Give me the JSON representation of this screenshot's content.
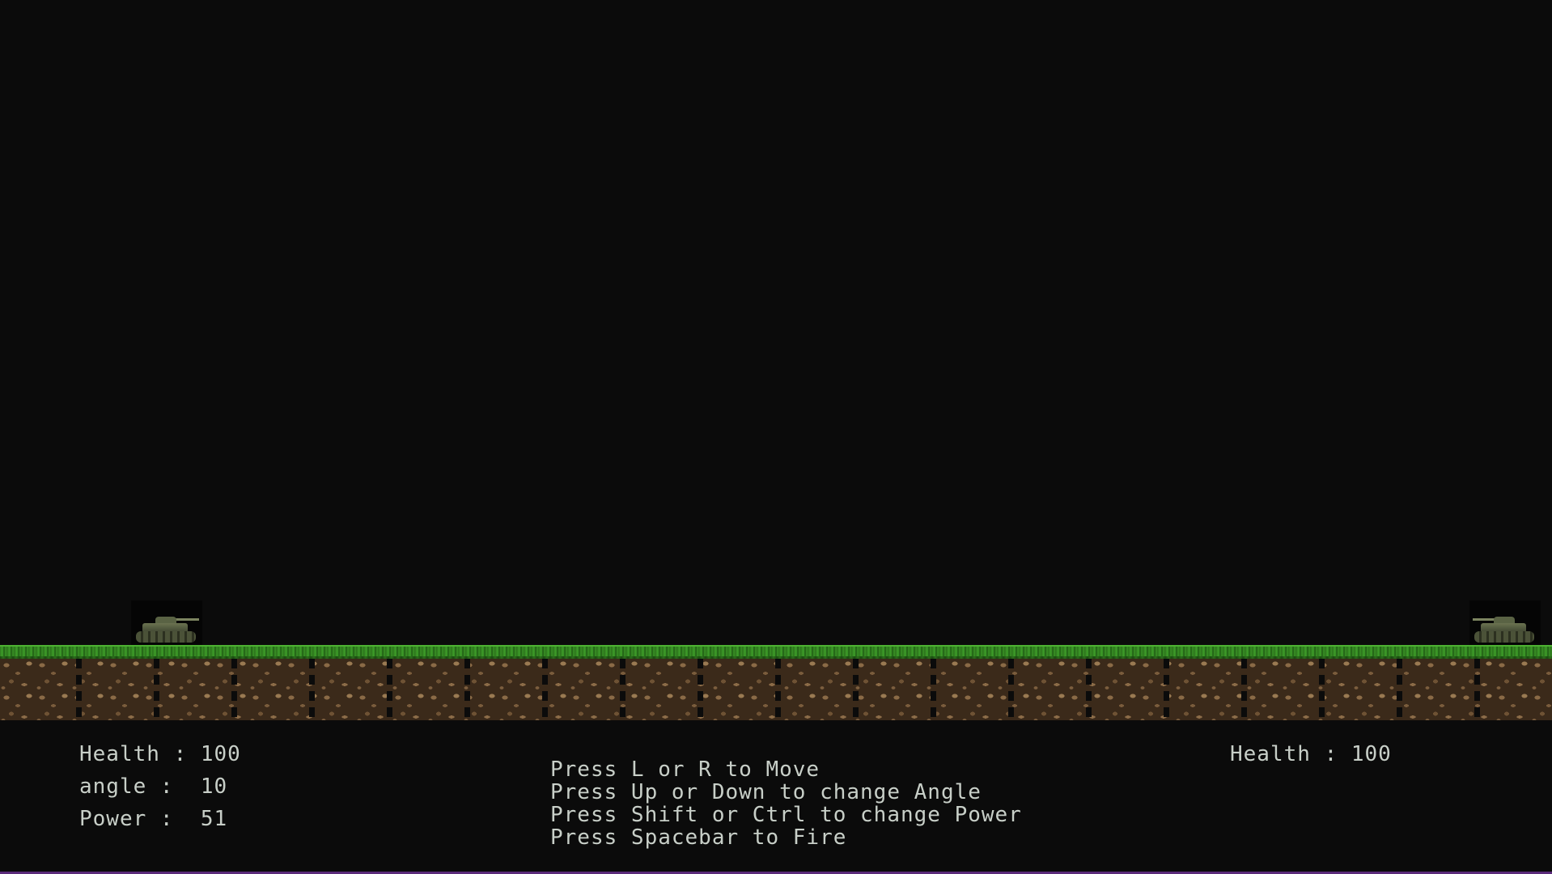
{
  "player1": {
    "health": "Health : 100",
    "angle": "angle :  10",
    "power": "Power :  51"
  },
  "player2": {
    "health": "Health : 100"
  },
  "instructions": [
    "Press L or R to Move",
    "Press Up or Down to change Angle",
    "Press Shift or Ctrl to change Power",
    "Press Spacebar to Fire"
  ],
  "colors": {
    "background": "#0b0b0b",
    "text": "#c8cfc8",
    "grass": "#3fa02a",
    "dirt": "#3b2a1a"
  },
  "icons": {
    "player1_tank": "tank-icon",
    "player2_tank": "tank-icon"
  }
}
